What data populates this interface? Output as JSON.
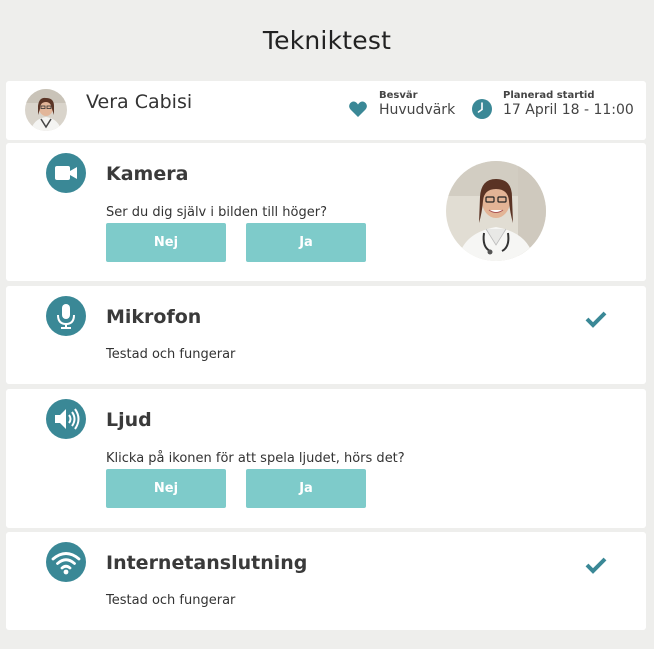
{
  "page": {
    "title": "Tekniktest"
  },
  "patient": {
    "name": "Vera Cabisi",
    "complaint_label": "Besvär",
    "complaint_value": "Huvudvärk",
    "start_label": "Planerad startid",
    "start_value": "17 April 18 - 11:00"
  },
  "sections": {
    "camera": {
      "title": "Kamera",
      "text": "Ser du dig själv i bilden till höger?",
      "no_label": "Nej",
      "yes_label": "Ja"
    },
    "microphone": {
      "title": "Mikrofon",
      "status": "Testad och fungerar"
    },
    "sound": {
      "title": "Ljud",
      "text": "Klicka på ikonen för att spela ljudet, hörs det?",
      "no_label": "Nej",
      "yes_label": "Ja"
    },
    "internet": {
      "title": "Internetanslutning",
      "status": "Testad och fungerar"
    }
  },
  "icons": {
    "avatar": "avatar",
    "heart": "heart-icon",
    "clock": "clock-icon",
    "camera": "camera-icon",
    "microphone": "microphone-icon",
    "speaker": "speaker-icon",
    "wifi": "wifi-icon",
    "check": "check-icon"
  },
  "colors": {
    "background": "#eeeeec",
    "card": "#ffffff",
    "accent": "#3a8896",
    "button": "#7ecbca"
  }
}
